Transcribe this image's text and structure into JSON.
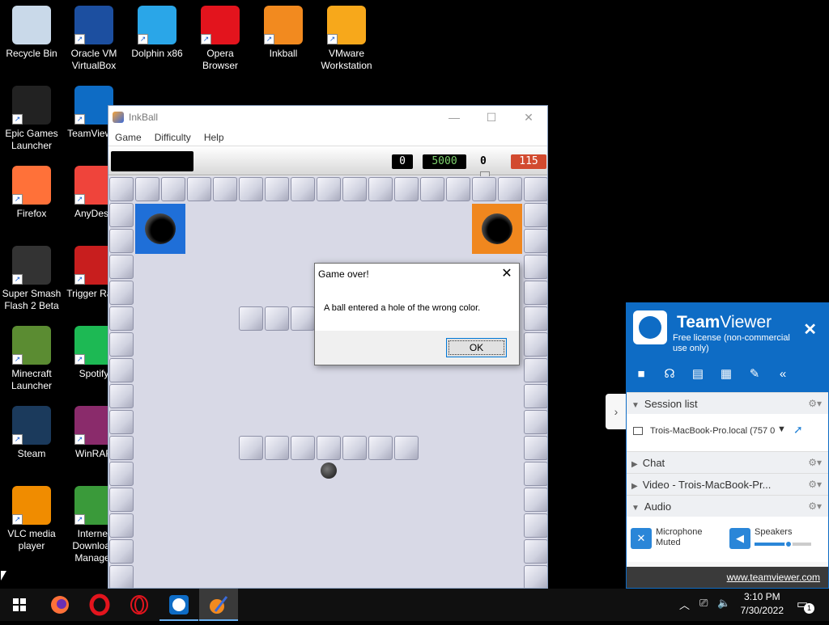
{
  "desktop": {
    "icons": [
      {
        "label": "Recycle Bin",
        "icon": "recycle-bin-icon",
        "color": "#c9d9e9"
      },
      {
        "label": "Oracle VM VirtualBox",
        "icon": "virtualbox-icon",
        "color": "#1c4fa0"
      },
      {
        "label": "Dolphin x86",
        "icon": "dolphin-icon",
        "color": "#2aa6e8"
      },
      {
        "label": "Opera Browser",
        "icon": "opera-icon",
        "color": "#e3141d"
      },
      {
        "label": "Inkball",
        "icon": "inkball-icon",
        "color": "#f28a1f"
      },
      {
        "label": "VMware Workstation",
        "icon": "vmware-icon",
        "color": "#f7a81b"
      },
      {
        "label": "Epic Games Launcher",
        "icon": "epic-games-icon",
        "color": "#222222"
      },
      {
        "label": "TeamViewer",
        "icon": "teamviewer-icon",
        "color": "#0e6cc5"
      },
      {
        "label": "Firefox",
        "icon": "firefox-icon",
        "color": "#ff7139"
      },
      {
        "label": "AnyDesk",
        "icon": "anydesk-icon",
        "color": "#ef443b"
      },
      {
        "label": "Super Smash Flash 2 Beta",
        "icon": "smash-flash-icon",
        "color": "#333333"
      },
      {
        "label": "Trigger Rally",
        "icon": "trigger-rally-icon",
        "color": "#c81e1e"
      },
      {
        "label": "Minecraft Launcher",
        "icon": "minecraft-icon",
        "color": "#5b8c32"
      },
      {
        "label": "Spotify",
        "icon": "spotify-icon",
        "color": "#1db954"
      },
      {
        "label": "Steam",
        "icon": "steam-icon",
        "color": "#1b3a5c"
      },
      {
        "label": "WinRAR",
        "icon": "winrar-icon",
        "color": "#8a2b6b"
      },
      {
        "label": "VLC media player",
        "icon": "vlc-icon",
        "color": "#f08c00"
      },
      {
        "label": "Internet Download Manager",
        "icon": "idm-icon",
        "color": "#3a9a3a"
      }
    ]
  },
  "inkball": {
    "title": "InkBall",
    "menu": [
      "Game",
      "Difficulty",
      "Help"
    ],
    "scores": {
      "balls_in": "0",
      "points": "5000",
      "misses": "0",
      "time": "115"
    },
    "colors": {
      "blue": "#1f6fd8",
      "orange": "#f0871e"
    }
  },
  "dialog": {
    "title": "Game over!",
    "close_glyph": "✕",
    "message": "A ball entered a hole of the wrong color.",
    "ok_label": "OK"
  },
  "teamviewer": {
    "name_bold": "Team",
    "name_rest": "Viewer",
    "license": "Free license (non-commercial use only)",
    "sessions_title": "Session list",
    "session_item": "Trois-MacBook-Pro.local (757 0",
    "chat_title": "Chat",
    "video_title": "Video - Trois-MacBook-Pr...",
    "audio_title": "Audio",
    "mic_label": "Microphone",
    "mic_status": "Muted",
    "speakers_label": "Speakers",
    "speaker_level": 0.6,
    "footer_link": "www.teamviewer.com",
    "accent": "#0e6cc5"
  },
  "taskbar": {
    "time": "3:10 PM",
    "date": "7/30/2022",
    "notification_count": "1"
  }
}
